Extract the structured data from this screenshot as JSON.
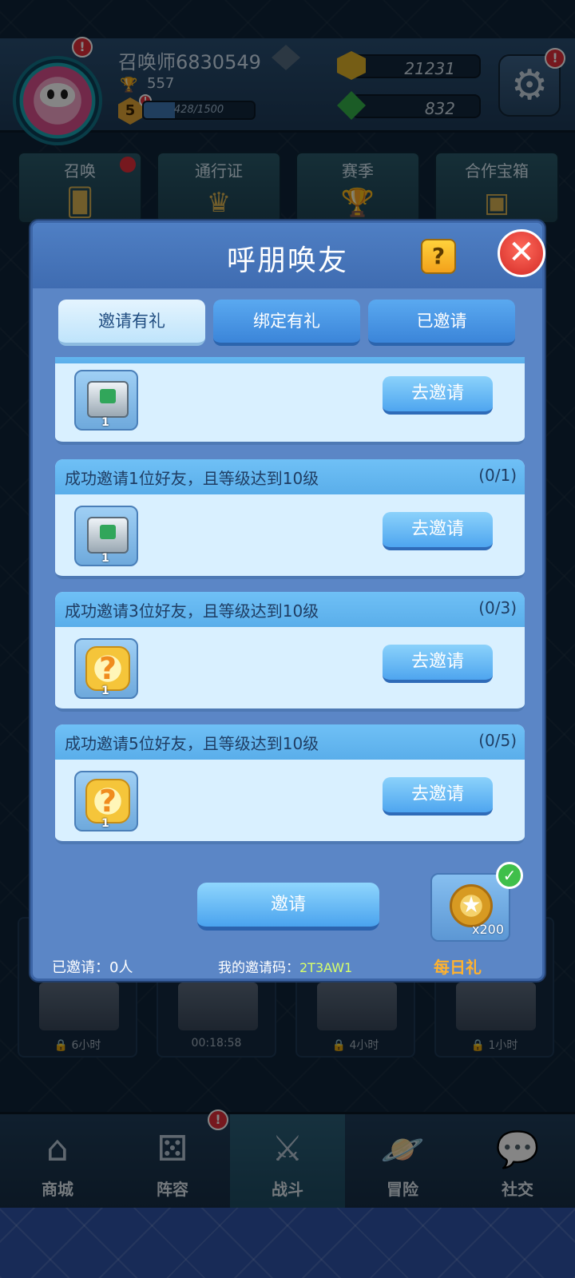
{
  "player": {
    "name": "召唤师6830549",
    "trophies": "557",
    "level": "5",
    "xp_text": "428/1500",
    "xp_fraction": 0.285,
    "gold": "21231",
    "gems": "832",
    "avatar_alert": "!",
    "level_alert": "!",
    "settings_alert": "!"
  },
  "features": [
    {
      "label": "召唤"
    },
    {
      "label": "通行证"
    },
    {
      "label": "赛季"
    },
    {
      "label": "合作宝箱"
    }
  ],
  "chests": [
    {
      "timer": "6小时",
      "locked": true
    },
    {
      "timer": "00:18:58",
      "locked": false
    },
    {
      "timer": "4小时",
      "locked": true
    },
    {
      "timer": "1小时",
      "locked": true
    }
  ],
  "nav": [
    {
      "label": "商城",
      "icon": "shop-icon"
    },
    {
      "label": "阵容",
      "icon": "dice-icon",
      "alert": "!"
    },
    {
      "label": "战斗",
      "icon": "swords-icon",
      "active": true
    },
    {
      "label": "冒险",
      "icon": "planet-icon"
    },
    {
      "label": "社交",
      "icon": "chat-icon"
    }
  ],
  "modal": {
    "title": "呼朋唤友",
    "help": "?",
    "close": "✕",
    "tabs": [
      {
        "label": "邀请有礼",
        "active": true
      },
      {
        "label": "绑定有礼",
        "active": false
      },
      {
        "label": "已邀请",
        "active": false
      }
    ],
    "tasks": [
      {
        "title": "",
        "progress": "",
        "reward": "chest",
        "count": "1",
        "button": "去邀请"
      },
      {
        "title": "成功邀请1位好友，且等级达到10级",
        "progress": "(0/1)",
        "reward": "chest",
        "count": "1",
        "button": "去邀请"
      },
      {
        "title": "成功邀请3位好友，且等级达到10级",
        "progress": "(0/3)",
        "reward": "mystery",
        "count": "1",
        "button": "去邀请"
      },
      {
        "title": "成功邀请5位好友，且等级达到10级",
        "progress": "(0/5)",
        "reward": "mystery",
        "count": "1",
        "button": "去邀请"
      }
    ],
    "invite_button": "邀请",
    "daily_reward_qty": "x200",
    "invited_count": "已邀请：0人",
    "invite_code_label": "我的邀请码：",
    "invite_code": "2T3AW1",
    "daily_label": "每日礼"
  }
}
